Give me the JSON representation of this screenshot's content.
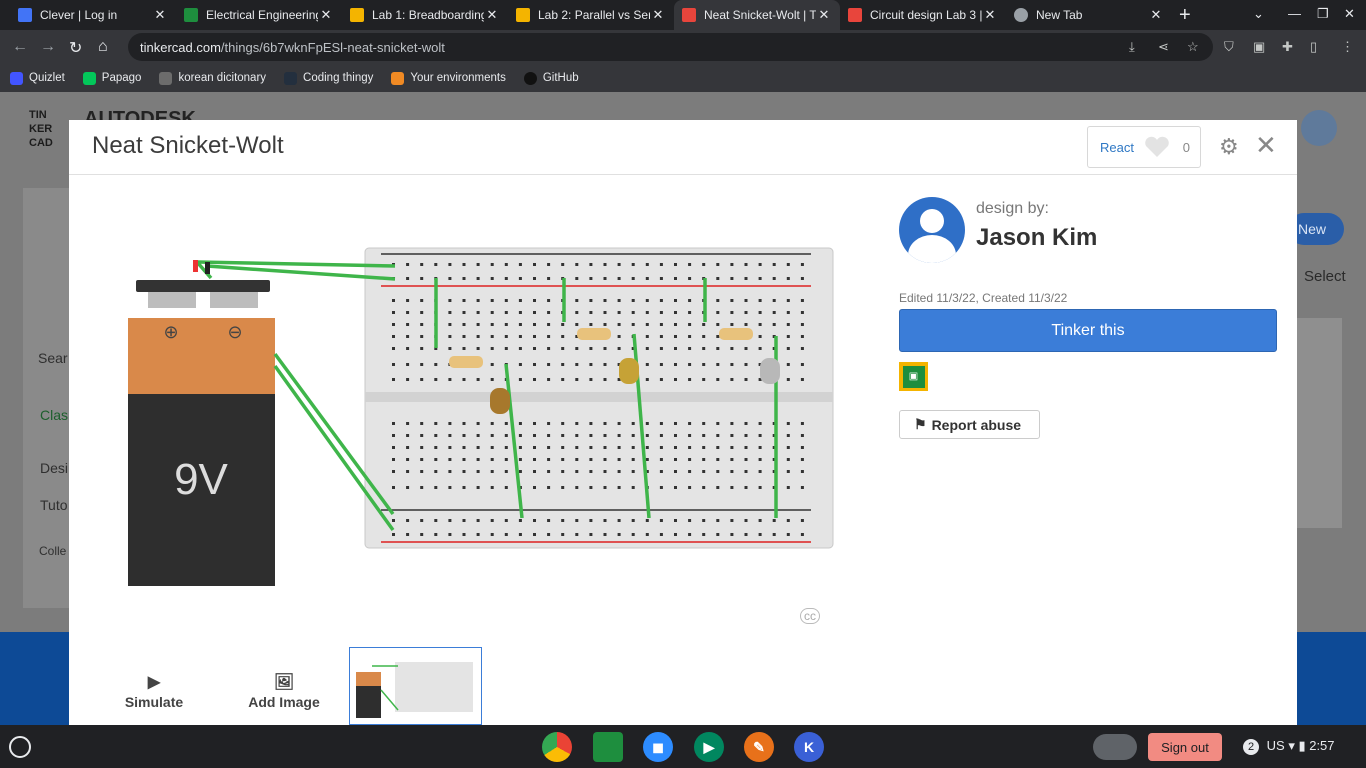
{
  "tabs": [
    {
      "title": "Clever | Log in",
      "color": "#4274f6"
    },
    {
      "title": "Electrical Engineering",
      "color": "#1e8e3e"
    },
    {
      "title": "Lab 1: Breadboarding",
      "color": "#f4b400"
    },
    {
      "title": "Lab 2: Parallel vs Serie",
      "color": "#f4b400"
    },
    {
      "title": "Neat Snicket-Wolt | Ti",
      "color": "#e8453c",
      "active": true
    },
    {
      "title": "Circuit design Lab 3 | T",
      "color": "#e8453c"
    },
    {
      "title": "New Tab",
      "color": "#9aa0a6"
    }
  ],
  "address": {
    "host": "tinkercad.com",
    "path": "/things/6b7wknFpESl-neat-snicket-wolt"
  },
  "bookmarks": [
    {
      "label": "Quizlet",
      "color": "#4255ff"
    },
    {
      "label": "Papago",
      "color": "#03c75a"
    },
    {
      "label": "korean dicitonary",
      "color": "#6c6c6c"
    },
    {
      "label": "Coding thingy",
      "color": "#232f3e"
    },
    {
      "label": "Your environments",
      "color": "#f08a24"
    },
    {
      "label": "GitHub",
      "color": "#111"
    }
  ],
  "site": {
    "logo_lines": [
      "TIN",
      "KER",
      "CAD"
    ],
    "brand": "AUTODESK",
    "new_label": "New",
    "select_label": "Select",
    "search_placeholder": "Sear",
    "side_items": [
      "Clas",
      "Desi",
      "Tuto",
      "Colle"
    ]
  },
  "modal": {
    "title": "Neat Snicket-Wolt",
    "react_label": "React",
    "react_count": "0",
    "design_by": "design by:",
    "author": "Jason Kim",
    "edited": "Edited 11/3/22, Created 11/3/22",
    "tinker_label": "Tinker this",
    "report_label": "Report abuse",
    "simulate_label": "Simulate",
    "add_image_label": "Add Image",
    "battery_label": "9V",
    "cc": "cc"
  },
  "taskbar": {
    "signout": "Sign out",
    "notif": "2",
    "locale": "US",
    "time": "2:57"
  }
}
